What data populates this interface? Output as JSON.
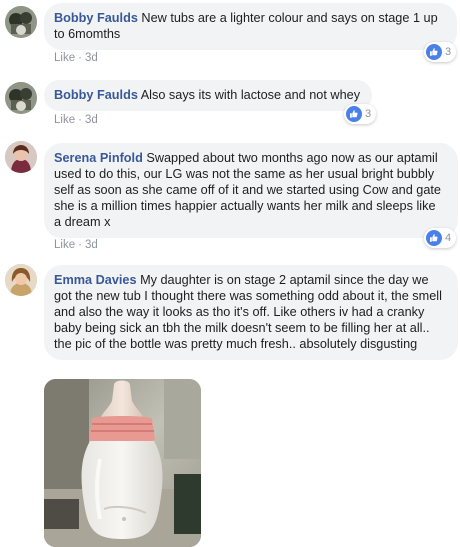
{
  "comments": [
    {
      "author": "Bobby Faulds",
      "text": "New tubs are a lighter colour and says on stage 1 up to 6momths",
      "like_label": "Like",
      "separator": "·",
      "time": "3d",
      "reaction_count": "3"
    },
    {
      "author": "Bobby Faulds",
      "text": "Also says its with lactose and not whey",
      "like_label": "Like",
      "separator": "·",
      "time": "3d",
      "reaction_count": "3"
    },
    {
      "author": "Serena Pinfold",
      "text": "Swapped about two months ago now as our aptamil used to do this, our LG was not the same as her usual bright bubbly self as soon as she came off of it and we started using Cow and gate she is a million times happier actually wants her milk and sleeps like a dream x",
      "like_label": "Like",
      "separator": "·",
      "time": "3d",
      "reaction_count": "4"
    },
    {
      "author": "Emma Davies",
      "text": "My daughter is on stage 2 aptamil since the day we got the new tub I thought there was something odd about it, the smell and also the way it looks as tho it's off. Like others iv had a cranky baby being sick an tbh the milk doesn't seem to be filling her at all.. the pic of the bottle was pretty much fresh.. absolutely disgusting"
    }
  ],
  "colors": {
    "author": "#385898",
    "bubble": "#f2f3f5",
    "like_blue": "#4a80ea",
    "meta": "#90949c"
  },
  "icons": {
    "reaction": "thumbs-up-icon"
  }
}
